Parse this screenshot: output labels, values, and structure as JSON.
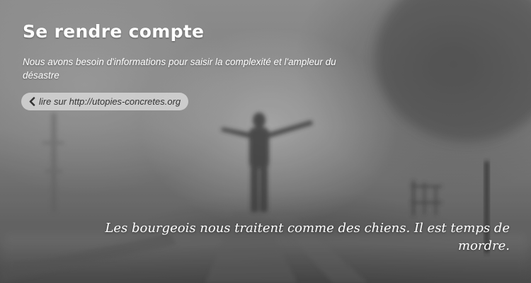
{
  "header": {
    "title": "Se rendre compte",
    "subtitle": "Nous avons besoin d'informations pour saisir la complexité et l'ampleur du désastre"
  },
  "link": {
    "label": "lire sur http://utopies-concretes.org",
    "icon": "chevron-left-icon"
  },
  "quote": {
    "text": "Les bourgeois nous traitent comme des chiens. Il est temps de mordre."
  },
  "colors": {
    "text": "#ffffff",
    "link_bg": "#dcdcdc",
    "link_text": "#333333"
  }
}
